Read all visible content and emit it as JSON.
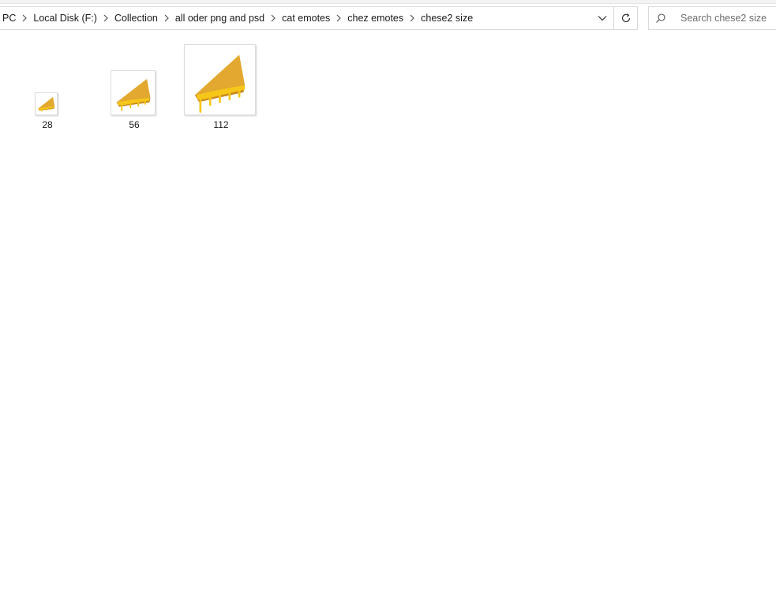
{
  "breadcrumb": {
    "items": [
      {
        "label": "PC"
      },
      {
        "label": "Local Disk (F:)"
      },
      {
        "label": "Collection"
      },
      {
        "label": "all oder png and psd"
      },
      {
        "label": "cat emotes"
      },
      {
        "label": "chez emotes"
      },
      {
        "label": "chese2 size"
      }
    ]
  },
  "search": {
    "placeholder": "Search chese2 size"
  },
  "files": [
    {
      "name": "28",
      "icon": "grilled-cheese-icon"
    },
    {
      "name": "56",
      "icon": "grilled-cheese-icon"
    },
    {
      "name": "112",
      "icon": "grilled-cheese-icon"
    }
  ],
  "colors": {
    "bread": "#E3A82F",
    "bread_shadow": "#C98A1E",
    "cheese": "#F6C718",
    "border": "#D9D9D9"
  }
}
